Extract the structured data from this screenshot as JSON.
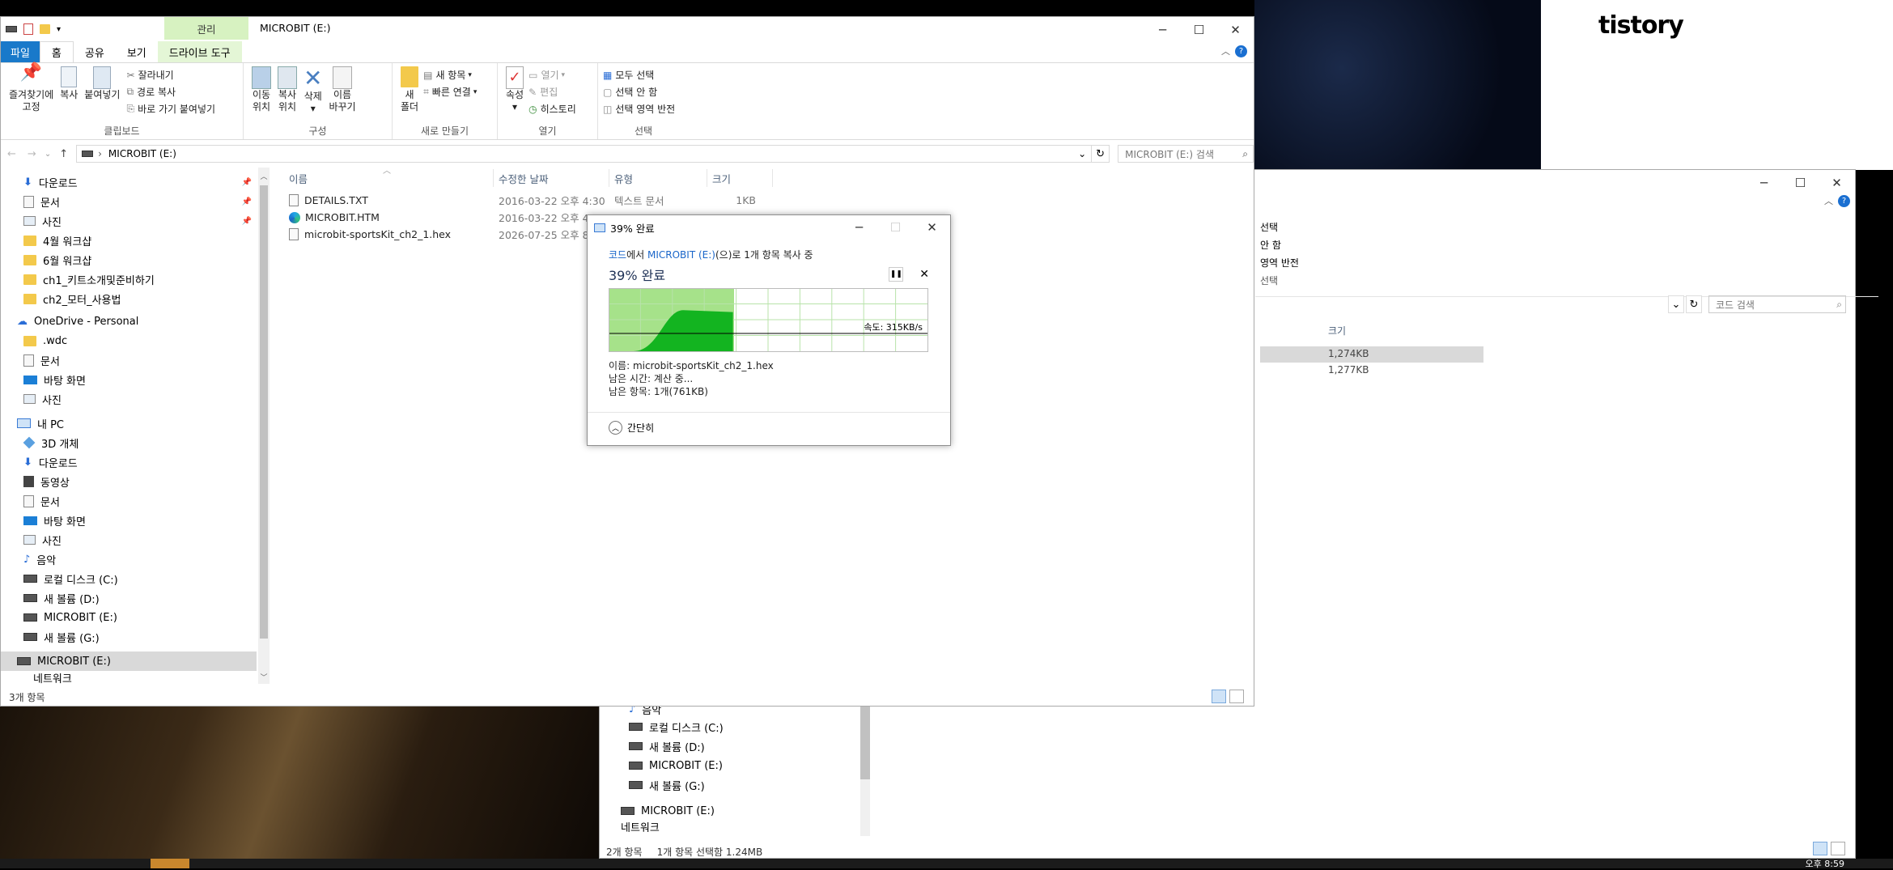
{
  "background": {
    "site_logo": "tistory"
  },
  "main_window": {
    "title": "MICROBIT (E:)",
    "context_tab": "관리",
    "ribbon_tabs": [
      "파일",
      "홈",
      "공유",
      "보기",
      "드라이브 도구"
    ],
    "clipboard": {
      "pin_label_1": "즐겨찾기에",
      "pin_label_2": "고정",
      "copy": "복사",
      "paste": "붙여넣기",
      "cut": "잘라내기",
      "copy_path": "경로 복사",
      "paste_shortcut": "바로 가기 붙여넣기",
      "group": "클립보드"
    },
    "organize": {
      "move_1": "이동",
      "move_2": "위치",
      "copyto_1": "복사",
      "copyto_2": "위치",
      "delete": "삭제",
      "rename_1": "이름",
      "rename_2": "바꾸기",
      "group": "구성"
    },
    "new": {
      "folder_1": "새",
      "folder_2": "폴더",
      "new_item": "새 항목",
      "easy_access": "빠른 연결",
      "group": "새로 만들기"
    },
    "open": {
      "properties": "속성",
      "open": "열기",
      "edit": "편집",
      "history": "히스토리",
      "group": "열기"
    },
    "select": {
      "all": "모두 선택",
      "none": "선택 안 함",
      "invert": "선택 영역 반전",
      "group": "선택"
    },
    "address": {
      "path": "MICROBIT (E:)",
      "search_placeholder": "MICROBIT (E:) 검색"
    },
    "columns": [
      "이름",
      "수정한 날짜",
      "유형",
      "크기"
    ],
    "files": [
      {
        "name": "DETAILS.TXT",
        "date": "2016-03-22 오후 4:30",
        "type": "텍스트 문서",
        "size": "1KB",
        "icon": "text-file-icon"
      },
      {
        "name": "MICROBIT.HTM",
        "date": "2016-03-22 오후 4:",
        "type": "",
        "size": "",
        "icon": "edge-html-icon"
      },
      {
        "name": "microbit-sportsKit_ch2_1.hex",
        "date": "2026-07-25 오후 8:",
        "type": "",
        "size": "",
        "icon": "hex-file-icon"
      }
    ],
    "nav": {
      "quick": [
        {
          "label": "다운로드",
          "icon": "download-icon"
        },
        {
          "label": "문서",
          "icon": "documents-icon"
        },
        {
          "label": "사진",
          "icon": "pictures-icon"
        },
        {
          "label": "4월 워크샵",
          "icon": "folder-icon"
        },
        {
          "label": "6월 워크샵",
          "icon": "folder-icon"
        },
        {
          "label": "ch1_키트소개및준비하기",
          "icon": "folder-icon"
        },
        {
          "label": "ch2_모터_사용법",
          "icon": "folder-icon"
        }
      ],
      "onedrive": "OneDrive - Personal",
      "onedrive_items": [
        {
          "label": ".wdc",
          "icon": "folder-icon"
        },
        {
          "label": "문서",
          "icon": "documents-icon"
        },
        {
          "label": "바탕 화면",
          "icon": "desktop-icon"
        },
        {
          "label": "사진",
          "icon": "pictures-icon"
        }
      ],
      "pc": "내 PC",
      "pc_items": [
        {
          "label": "3D 개체",
          "icon": "3d-objects-icon"
        },
        {
          "label": "다운로드",
          "icon": "download-icon"
        },
        {
          "label": "동영상",
          "icon": "videos-icon"
        },
        {
          "label": "문서",
          "icon": "documents-icon"
        },
        {
          "label": "바탕 화면",
          "icon": "desktop-icon"
        },
        {
          "label": "사진",
          "icon": "pictures-icon"
        },
        {
          "label": "음악",
          "icon": "music-icon"
        },
        {
          "label": "로컬 디스크 (C:)",
          "icon": "drive-icon"
        },
        {
          "label": "새 볼륨 (D:)",
          "icon": "drive-icon"
        },
        {
          "label": "MICROBIT (E:)",
          "icon": "drive-icon"
        },
        {
          "label": "새 볼륨 (G:)",
          "icon": "drive-icon"
        }
      ],
      "selected": "MICROBIT (E:)",
      "network": "네트워크"
    },
    "status": "3개 항목"
  },
  "second_window": {
    "ribbon_select": {
      "all": "선택",
      "none": "안 함",
      "invert": "영역 반전",
      "group": "선택"
    },
    "search_placeholder": "코드 검색",
    "size_column": "크기",
    "sizes": [
      "1,274KB",
      "1,277KB"
    ],
    "nav_items": [
      {
        "label": "음악",
        "icon": "music-icon"
      },
      {
        "label": "로컬 디스크 (C:)",
        "icon": "drive-icon"
      },
      {
        "label": "새 볼륨 (D:)",
        "icon": "drive-icon"
      },
      {
        "label": "MICROBIT (E:)",
        "icon": "drive-icon"
      },
      {
        "label": "새 볼륨 (G:)",
        "icon": "drive-icon"
      }
    ],
    "nav_selected": "MICROBIT (E:)",
    "nav_network": "네트워크",
    "status_count": "2개 항목",
    "status_selection": "1개 항목 선택함 1.24MB"
  },
  "copy_dialog": {
    "title": "39% 완료",
    "source": "코드",
    "source_suffix": "에서 ",
    "destination": "MICROBIT (E:)",
    "dest_suffix": "(으)로 1개 항목 복사 중",
    "heading": "39% 완료",
    "progress_percent": 39,
    "speed": "속도: 315KB/s",
    "name_label": "이름: microbit-sportsKit_ch2_1.hex",
    "time_label": "남은 시간: 계산 중...",
    "items_label": "남은 항목: 1개(761KB)",
    "collapse": "간단히",
    "colors": {
      "progress_fill": "#a6e28a",
      "graph_fill": "#13b420"
    }
  },
  "taskbar": {
    "clock": "오후 8:59"
  }
}
